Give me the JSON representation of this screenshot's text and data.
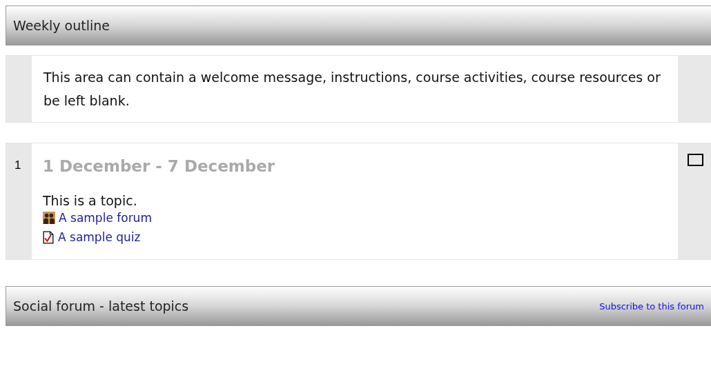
{
  "outline": {
    "title": "Weekly outline"
  },
  "intro": {
    "text": "This area can contain a welcome message, instructions, course activities, course resources or be left blank."
  },
  "sections": [
    {
      "number": "1",
      "dates": "1 December - 7 December",
      "summary": "This is a topic.",
      "activities": [
        {
          "kind": "forum",
          "label": "A sample forum"
        },
        {
          "kind": "quiz",
          "label": "A sample quiz"
        }
      ]
    }
  ],
  "forum_block": {
    "title": "Social forum - latest topics",
    "subscribe_link": "Subscribe to this forum"
  }
}
